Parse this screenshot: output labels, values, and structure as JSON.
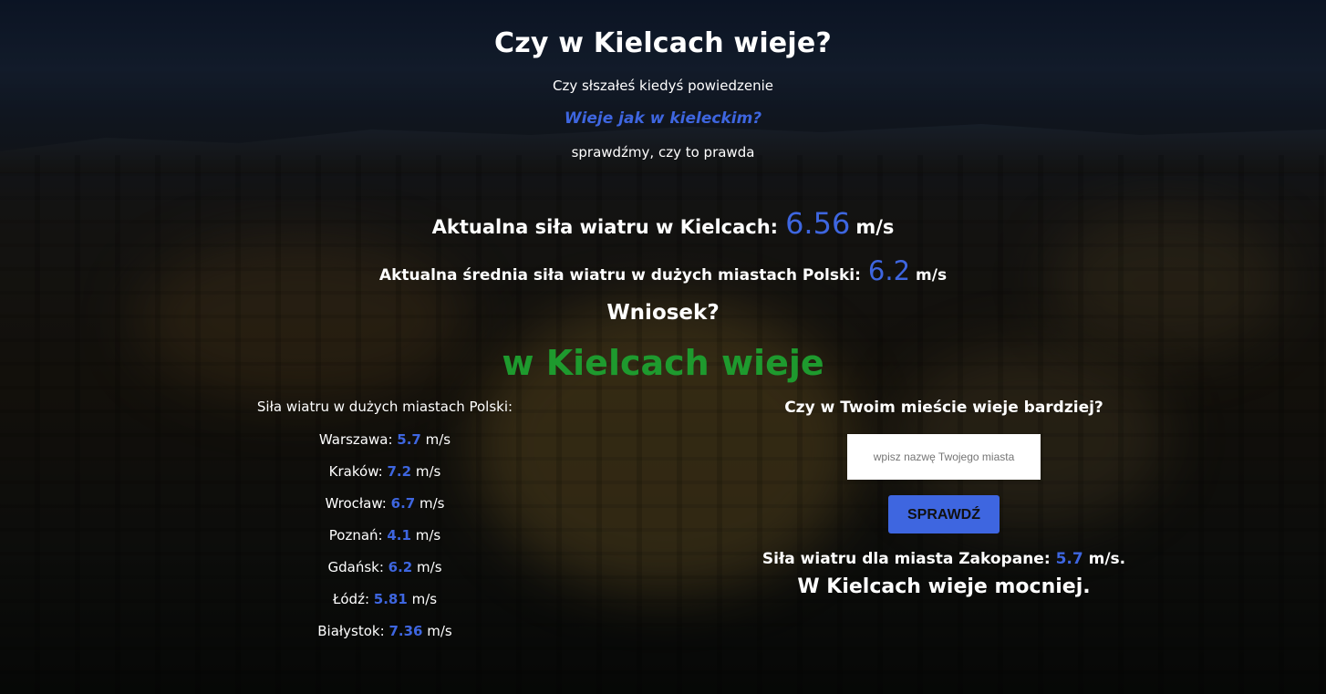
{
  "colors": {
    "accent": "#3e66e0",
    "conclusion": "#1e9a2e",
    "text": "#ffffff"
  },
  "header": {
    "title": "Czy w Kielcach wieje?",
    "intro": "Czy słszałeś kiedyś powiedzenie",
    "quote": "Wieje jak w kieleckim?",
    "outro": "sprawdźmy, czy to prawda"
  },
  "current": {
    "label": "Aktualna siła wiatru w Kielcach:",
    "value": "6.56",
    "unit": "m/s"
  },
  "average": {
    "label": "Aktualna średnia siła wiatru w dużych miastach Polski:",
    "value": "6.2",
    "unit": "m/s"
  },
  "conclusion": {
    "label": "Wniosek?",
    "text": "w Kielcach wieje"
  },
  "cities": {
    "heading": "Siła wiatru w dużych miastach Polski:",
    "unit": "m/s",
    "items": [
      {
        "name": "Warszawa:",
        "value": "5.7"
      },
      {
        "name": "Kraków:",
        "value": "7.2"
      },
      {
        "name": "Wrocław:",
        "value": "6.7"
      },
      {
        "name": "Poznań:",
        "value": "4.1"
      },
      {
        "name": "Gdańsk:",
        "value": "6.2"
      },
      {
        "name": "Łódź:",
        "value": "5.81"
      },
      {
        "name": "Białystok:",
        "value": "7.36"
      }
    ]
  },
  "check": {
    "question": "Czy w Twoim mieście wieje bardziej?",
    "input_value": "",
    "input_placeholder": "wpisz nazwę Twojego miasta",
    "button_label": "SPRAWDŹ",
    "result_prefix": "Siła wiatru dla miasta Zakopane:",
    "result_value": "5.7",
    "result_unit": "m/s.",
    "verdict": "W Kielcach wieje mocniej."
  }
}
